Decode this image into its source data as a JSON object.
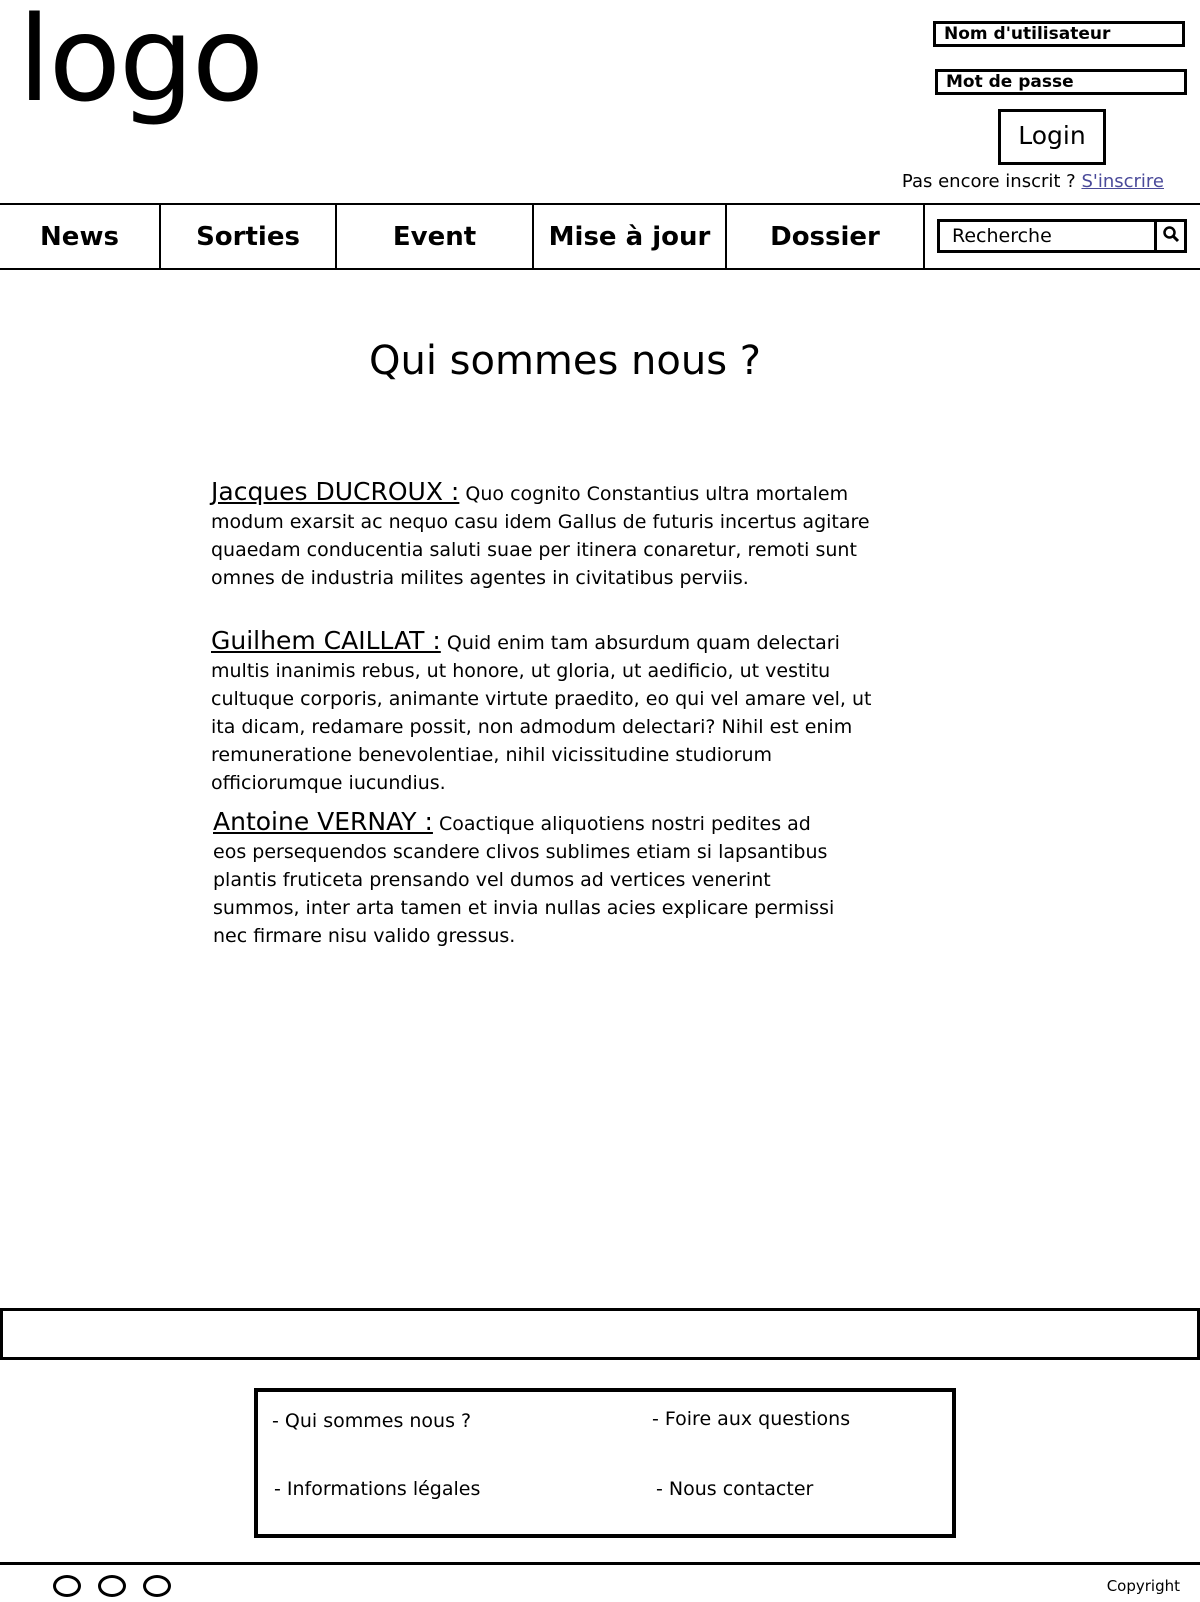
{
  "header": {
    "logo_text": "logo",
    "username_placeholder": "Nom d'utilisateur",
    "password_placeholder": "Mot de passe",
    "login_label": "Login",
    "register_prompt": "Pas encore inscrit ?",
    "register_link": "S'inscrire"
  },
  "nav": {
    "items": [
      "News",
      "Sorties",
      "Event",
      "Mise à jour",
      "Dossier"
    ],
    "search_placeholder": "Recherche",
    "search_icon": "search-icon"
  },
  "main": {
    "title": "Qui sommes nous ?",
    "bios": [
      {
        "name": "Jacques DUCROUX :",
        "text": "Quo cognito Constantius ultra mortalem modum exarsit ac nequo casu idem Gallus de futuris incertus agitare quaedam conducentia saluti suae per itinera conaretur, remoti sunt omnes de industria milites agentes in civitatibus perviis."
      },
      {
        "name": "Guilhem CAILLAT :",
        "text": "Quid enim tam absurdum quam delectari multis inanimis rebus, ut honore, ut gloria, ut aedificio, ut vestitu cultuque corporis, animante virtute praedito, eo qui vel amare vel, ut ita dicam, redamare possit, non admodum delectari? Nihil est enim remuneratione benevolentiae, nihil vicissitudine studiorum officiorumque iucundius."
      },
      {
        "name": "Antoine VERNAY :",
        "text": "Coactique aliquotiens nostri pedites ad eos persequendos scandere clivos sublimes etiam si lapsantibus plantis fruticeta prensando vel dumos ad vertices venerint summos, inter arta tamen et invia nullas acies explicare permissi nec firmare nisu valido gressus."
      }
    ]
  },
  "footer": {
    "links": [
      "- Qui sommes nous ?",
      "- Foire aux questions",
      "- Informations légales",
      "- Nous contacter"
    ],
    "copyright": "Copyright"
  }
}
